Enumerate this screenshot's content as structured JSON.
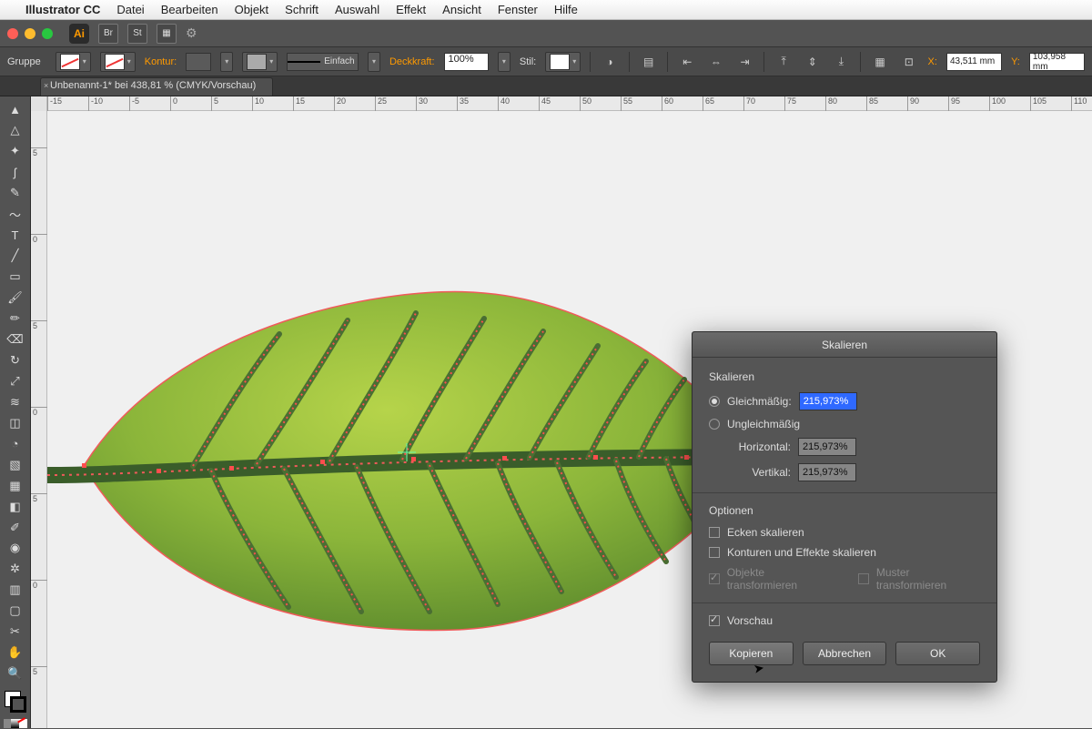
{
  "menubar": {
    "app": "Illustrator CC",
    "items": [
      "Datei",
      "Bearbeiten",
      "Objekt",
      "Schrift",
      "Auswahl",
      "Effekt",
      "Ansicht",
      "Fenster",
      "Hilfe"
    ]
  },
  "topbar": {
    "logo": "Ai",
    "btn1": "Br",
    "btn2": "St"
  },
  "control": {
    "selection": "Gruppe",
    "kontur_label": "Kontur:",
    "stroke_weight": "",
    "stroke_style": "Einfach",
    "deckkraft_label": "Deckkraft:",
    "opacity": "100%",
    "stil_label": "Stil:",
    "x_label": "X:",
    "x_value": "43,511 mm",
    "y_label": "Y:",
    "y_value": "103,958 mm"
  },
  "doc_tab": {
    "title": "Unbenannt-1* bei 438,81 % (CMYK/Vorschau)"
  },
  "ruler_h": [
    "-15",
    "-10",
    "-5",
    "0",
    "5",
    "10",
    "15",
    "20",
    "25",
    "30",
    "35",
    "40",
    "45",
    "50",
    "55",
    "60",
    "65",
    "70",
    "75",
    "80",
    "85",
    "90",
    "95",
    "100",
    "105",
    "110"
  ],
  "ruler_v": [
    "5",
    "0",
    "5",
    "0",
    "5",
    "0",
    "5"
  ],
  "dialog": {
    "title": "Skalieren",
    "section1": "Skalieren",
    "uniform_label": "Gleichmäßig:",
    "uniform_value": "215,973%",
    "nonuniform_label": "Ungleichmäßig",
    "horiz_label": "Horizontal:",
    "horiz_value": "215,973%",
    "vert_label": "Vertikal:",
    "vert_value": "215,973%",
    "section2": "Optionen",
    "opt_corners": "Ecken skalieren",
    "opt_strokes": "Konturen und Effekte skalieren",
    "opt_objects": "Objekte transformieren",
    "opt_patterns": "Muster transformieren",
    "preview_label": "Vorschau",
    "btn_copy": "Kopieren",
    "btn_cancel": "Abbrechen",
    "btn_ok": "OK"
  }
}
